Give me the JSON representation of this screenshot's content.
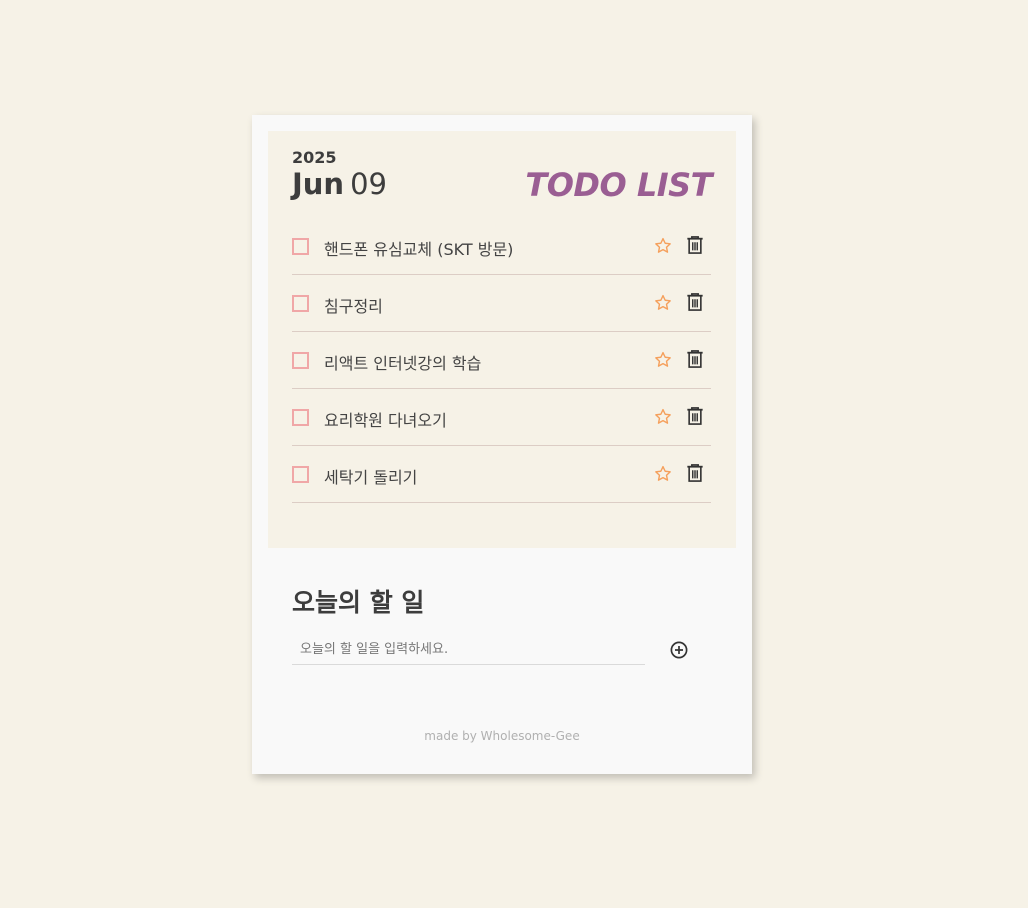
{
  "header": {
    "year": "2025",
    "month": "Jun",
    "day": "09",
    "title": "TODO LIST"
  },
  "todos": [
    {
      "text": "핸드폰 유심교체 (SKT 방문)",
      "checked": false,
      "starred": false
    },
    {
      "text": "침구정리",
      "checked": false,
      "starred": false
    },
    {
      "text": "리액트 인터넷강의 학습",
      "checked": false,
      "starred": false
    },
    {
      "text": "요리학원 다녀오기",
      "checked": false,
      "starred": false
    },
    {
      "text": "세탁기 돌리기",
      "checked": false,
      "starred": false
    }
  ],
  "icons": {
    "star": "star-icon",
    "trash": "trash-icon",
    "add": "plus-circle-icon"
  },
  "form": {
    "title": "오늘의 할 일",
    "placeholder": "오늘의 할 일을 입력하세요.",
    "value": ""
  },
  "footer": {
    "credit": "made by Wholesome-Gee"
  },
  "colors": {
    "background": "#f6f2e7",
    "card": "#f9f9f9",
    "title_accent": "#9a5e93",
    "checkbox_border": "#f0a7a7",
    "star": "#f5a05c"
  }
}
